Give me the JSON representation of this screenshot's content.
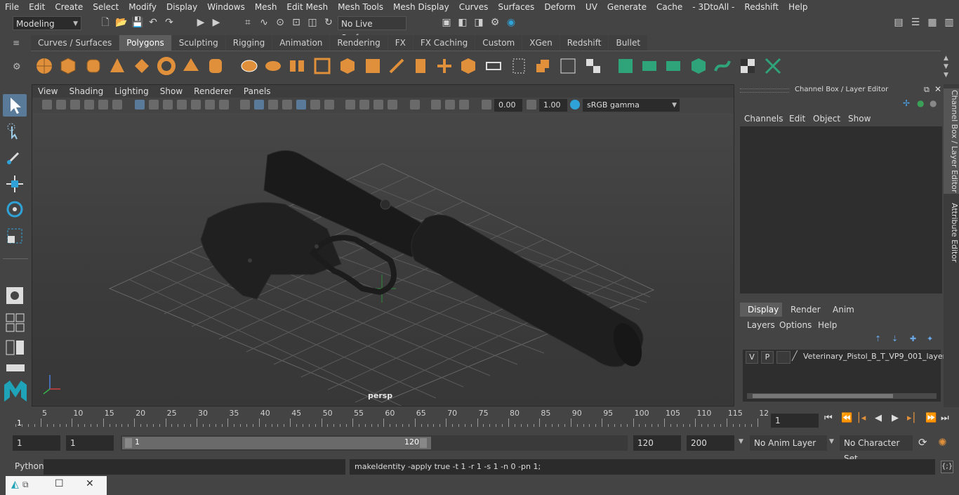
{
  "menubar": [
    "File",
    "Edit",
    "Create",
    "Select",
    "Modify",
    "Display",
    "Windows",
    "Mesh",
    "Edit Mesh",
    "Mesh Tools",
    "Mesh Display",
    "Curves",
    "Surfaces",
    "Deform",
    "UV",
    "Generate",
    "Cache",
    "- 3DtoAll -",
    "Redshift",
    "Help"
  ],
  "status": {
    "mode": "Modeling",
    "live_surface": "No Live Surface"
  },
  "shelf_tabs": [
    "Curves / Surfaces",
    "Polygons",
    "Sculpting",
    "Rigging",
    "Animation",
    "Rendering",
    "FX",
    "FX Caching",
    "Custom",
    "XGen",
    "Redshift",
    "Bullet"
  ],
  "shelf_active": "Polygons",
  "viewport": {
    "menu": [
      "View",
      "Shading",
      "Lighting",
      "Show",
      "Renderer",
      "Panels"
    ],
    "exposure": "0.00",
    "gamma": "1.00",
    "colorspace": "sRGB gamma",
    "camera_label": "persp"
  },
  "channel_box": {
    "title": "Channel Box / Layer Editor",
    "menu": [
      "Channels",
      "Edit",
      "Object",
      "Show"
    ],
    "layer_tabs": [
      "Display",
      "Render",
      "Anim"
    ],
    "layer_tab_active": "Display",
    "layer_menu": [
      "Layers",
      "Options",
      "Help"
    ],
    "layer": {
      "v": "V",
      "p": "P",
      "name": "Veterinary_Pistol_B_T_VP9_001_layer"
    }
  },
  "side_tabs": [
    "Channel Box / Layer Editor",
    "Attribute Editor"
  ],
  "timeline": {
    "ticks": [
      "5",
      "10",
      "15",
      "20",
      "25",
      "30",
      "35",
      "40",
      "45",
      "50",
      "55",
      "60",
      "65",
      "70",
      "75",
      "80",
      "85",
      "90",
      "95",
      "100",
      "105",
      "110",
      "115",
      "12"
    ],
    "start_marker": "1",
    "current_frame": "1"
  },
  "range": {
    "start": "1",
    "playback_start": "1",
    "slider_start": "1",
    "slider_end": "120",
    "playback_end": "120",
    "end": "200",
    "anim_layer": "No Anim Layer",
    "character_set": "No Character Set"
  },
  "command": {
    "language": "Python",
    "history": "makeIdentity -apply true -t 1 -r 1 -s 1 -n 0 -pn 1;"
  },
  "colors": {
    "accent": "#5a7a99",
    "shelf_green": "#2fa37a",
    "shelf_orange": "#e0903a"
  }
}
